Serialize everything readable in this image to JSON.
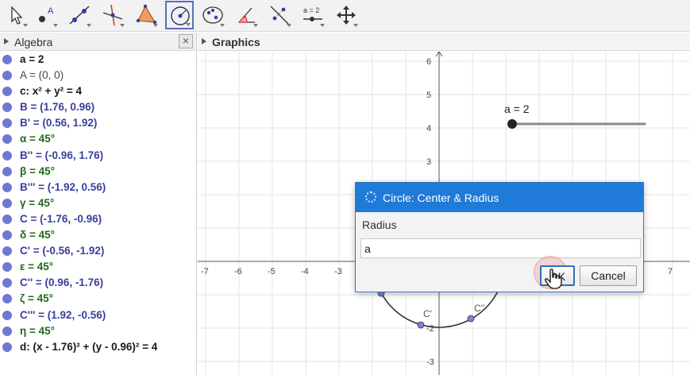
{
  "toolbar": {
    "tools": [
      {
        "name": "move-tool-icon"
      },
      {
        "name": "point-tool-icon",
        "letter": "A"
      },
      {
        "name": "line-tool-icon"
      },
      {
        "name": "perpendicular-line-tool-icon"
      },
      {
        "name": "polygon-tool-icon"
      },
      {
        "name": "circle-center-radius-tool-icon",
        "active": true
      },
      {
        "name": "conic-tool-icon"
      },
      {
        "name": "angle-tool-icon"
      },
      {
        "name": "reflect-tool-icon"
      },
      {
        "name": "slider-tool-icon",
        "label": "a = 2"
      },
      {
        "name": "move-graphics-view-tool-icon"
      }
    ]
  },
  "algebra": {
    "title": "Algebra",
    "close": "×",
    "items": [
      {
        "text": "a = 2",
        "style": "black"
      },
      {
        "text": "A = (0, 0)",
        "style": "gray"
      },
      {
        "text": "c: x² + y² = 4",
        "style": "black"
      },
      {
        "text": "B = (1.76, 0.96)",
        "style": "blue"
      },
      {
        "text": "B' = (0.56, 1.92)",
        "style": "blue"
      },
      {
        "text": "α = 45°",
        "style": "green"
      },
      {
        "text": "B'' = (-0.96, 1.76)",
        "style": "blue"
      },
      {
        "text": "β = 45°",
        "style": "green"
      },
      {
        "text": "B''' = (-1.92, 0.56)",
        "style": "blue"
      },
      {
        "text": "γ = 45°",
        "style": "green"
      },
      {
        "text": "C = (-1.76, -0.96)",
        "style": "blue"
      },
      {
        "text": "δ = 45°",
        "style": "green"
      },
      {
        "text": "C' = (-0.56, -1.92)",
        "style": "blue"
      },
      {
        "text": "ε = 45°",
        "style": "green"
      },
      {
        "text": "C'' = (0.96, -1.76)",
        "style": "blue"
      },
      {
        "text": "ζ = 45°",
        "style": "green"
      },
      {
        "text": "C''' = (1.92, -0.56)",
        "style": "blue"
      },
      {
        "text": "η = 45°",
        "style": "green"
      },
      {
        "text": "d: (x - 1.76)² + (y - 0.96)² = 4",
        "style": "black"
      }
    ]
  },
  "graphics": {
    "title": "Graphics",
    "x_ticks": [
      "-7",
      "-6",
      "-5",
      "-4",
      "-3",
      "7"
    ],
    "y_ticks": [
      "6",
      "5",
      "4",
      "3",
      "-2",
      "-3"
    ],
    "slider_label": "a = 2",
    "point_labels": [
      "C'",
      "C''"
    ]
  },
  "dialog": {
    "title": "Circle: Center & Radius",
    "radius_label": "Radius",
    "radius_value": "a",
    "ok": "OK",
    "cancel": "Cancel"
  },
  "colors": {
    "point": "#6f77d6",
    "dialog_title": "#1f7ad8",
    "grid": "#e6e6e6"
  }
}
